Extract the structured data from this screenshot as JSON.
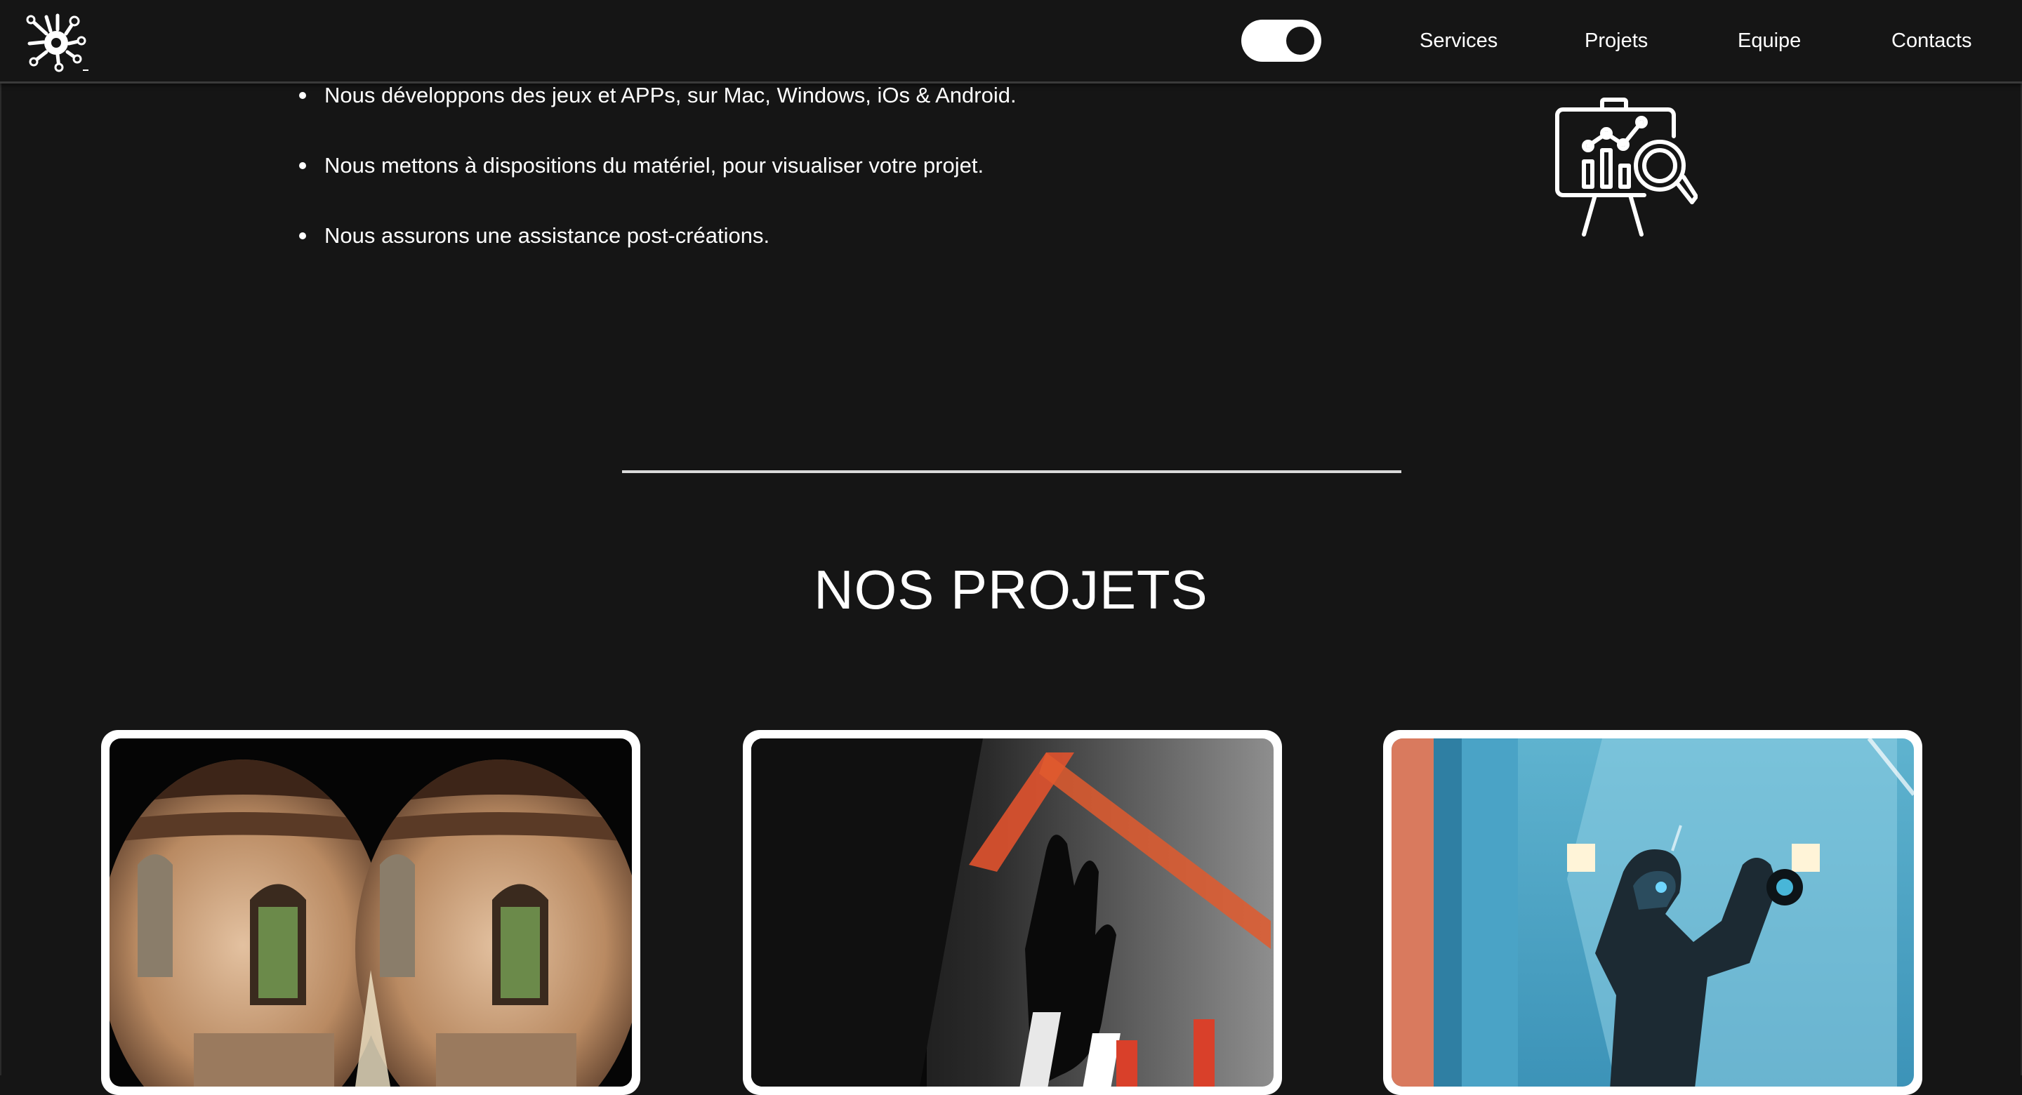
{
  "navbar": {
    "logo_icon": "circuit-splash-logo",
    "theme_toggle": {
      "state": "dark",
      "icon": "toggle-switch"
    },
    "links": [
      "Services",
      "Projets",
      "Equipe",
      "Contacts"
    ]
  },
  "services": {
    "items": [
      "Nous développons des jeux et APPs, sur Mac, Windows, iOs & Android.",
      "Nous mettons à dispositions du matériel, pour visualiser votre projet.",
      "Nous assurons une assistance post-créations."
    ],
    "illustration_icon": "presentation-board-analytics-icon"
  },
  "projects": {
    "title": "NOS PROJETS",
    "cards": [
      {
        "image": "vr-headset-stereo-view-old-building"
      },
      {
        "image": "hand-silhouette-red-lights"
      },
      {
        "image": "futuristic-robot-figure-blue-room"
      }
    ]
  },
  "colors": {
    "background": "#151515",
    "text": "#ffffff",
    "card_border": "#ffffff",
    "divider": "#d9d9d9"
  }
}
